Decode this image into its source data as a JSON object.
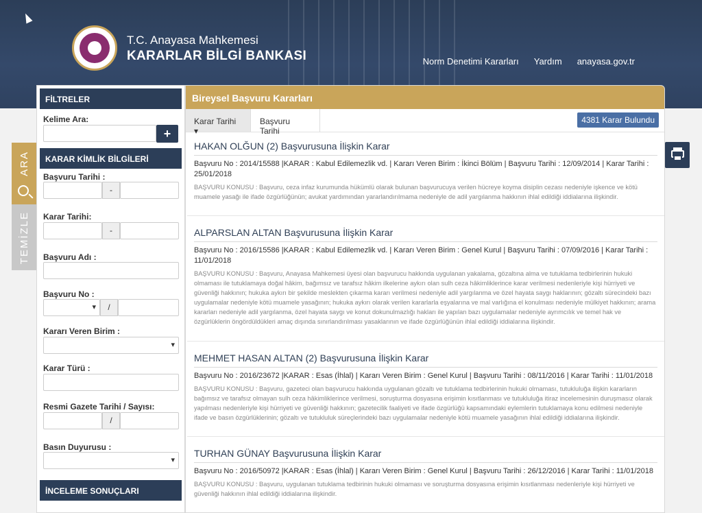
{
  "header": {
    "org": "T.C. Anayasa Mahkemesi",
    "title": "KARARLAR BİLGİ BANKASI",
    "nav": [
      "Norm Denetimi Kararları",
      "Yardım",
      "anayasa.gov.tr"
    ]
  },
  "side_tabs": {
    "search": "ARA",
    "clear": "TEMİZLE"
  },
  "filters": {
    "heading": "FİLTRELER",
    "keyword_label": "Kelime Ara:",
    "plus": "+",
    "identity_heading": "KARAR KİMLİK BİLGİLERİ",
    "application_date_label": "Başvuru Tarihi :",
    "decision_date_label": "Karar Tarihi:",
    "application_name_label": "Başvuru Adı :",
    "application_no_label": "Başvuru No :",
    "court_unit_label": "Kararı Veren Birim :",
    "decision_type_label": "Karar Türü :",
    "gazette_label": "Resmi Gazete Tarihi / Sayısı:",
    "press_label": "Basın Duyurusu :",
    "results_heading": "İNCELEME SONUÇLARI",
    "dash": "-",
    "slash": "/"
  },
  "results": {
    "heading": "Bireysel Başvuru Kararları",
    "sort_decision_date": "Karar Tarihi",
    "sort_application_date": "Başvuru Tarihi",
    "count": "4381 Karar Bulundu",
    "items": [
      {
        "title": "HAKAN OLĞUN (2) Başvurusuna İlişkin Karar",
        "meta": "Başvuru No : 2014/15588 |KARAR : Kabul Edilemezlik vd. | Kararı Veren Birim : İkinci Bölüm | Başvuru Tarihi : 12/09/2014 | Karar Tarihi : 25/01/2018",
        "summary": "BAŞVURU KONUSU : Başvuru, ceza infaz kurumunda hükümlü olarak bulunan başvurucuya verilen hücreye koyma disiplin cezası nedeniyle işkence ve kötü muamele yasağı ile ifade özgürlüğünün; avukat yardımından yararlandırılmama nedeniyle de adil yargılanma hakkının ihlal edildiği iddialarına ilişkindir."
      },
      {
        "title": "ALPARSLAN ALTAN Başvurusuna İlişkin Karar",
        "meta": "Başvuru No : 2016/15586 |KARAR : Kabul Edilemezlik vd. | Kararı Veren Birim : Genel Kurul | Başvuru Tarihi : 07/09/2016 | Karar Tarihi : 11/01/2018",
        "summary": "BAŞVURU KONUSU : Başvuru, Anayasa Mahkemesi üyesi olan başvurucu hakkında uygulanan yakalama, gözaltına alma ve tutuklama tedbirlerinin hukuki olmaması ile tutuklamaya doğal hâkim, bağımsız ve tarafsız hâkim ilkelerine aykırı olan sulh ceza hâkimliklerince karar verilmesi nedenleriyle kişi hürriyeti ve güvenliği hakkının; hukuka aykırı bir şekilde meslekten çıkarma kararı verilmesi nedeniyle adil yargılanma ve özel hayata saygı haklarının; gözaltı sürecindeki bazı uygulamalar nedeniyle kötü muamele yasağının; hukuka aykırı olarak verilen kararlarla eşyalarına ve mal varlığına el konulması nedeniyle mülkiyet hakkının; arama kararları nedeniyle adil yargılanma, özel hayata saygı ve konut dokunulmazlığı hakları ile yapılan bazı uygulamalar nedeniyle ayrımcılık ve temel hak ve özgürlüklerin öngördüldükleri amaç dışında sınırlandırılması yasaklarının ve ifade özgürlüğünün ihlal edildiği iddialarına ilişkindir."
      },
      {
        "title": "MEHMET HASAN ALTAN (2) Başvurusuna İlişkin Karar",
        "meta": "Başvuru No : 2016/23672 |KARAR : Esas (İhlal) | Kararı Veren Birim : Genel Kurul | Başvuru Tarihi : 08/11/2016 | Karar Tarihi : 11/01/2018",
        "summary": "BAŞVURU KONUSU : Başvuru, gazeteci olan başvurucu hakkında uygulanan gözaltı ve tutuklama tedbirlerinin hukuki olmaması, tutukluluğa ilişkin kararların bağımsız ve tarafsız olmayan sulh ceza hâkimliklerince verilmesi, soruşturma dosyasına erişimin kısıtlanması ve tutukluluğa itiraz incelemesinin duruşmasız olarak yapılması nedenleriyle kişi hürriyeti ve güvenliği hakkının; gazetecilik faaliyeti ve ifade özgürlüğü kapsamındaki eylemlerin tutuklamaya konu edilmesi nedeniyle ifade ve basın özgürlüklerinin; gözaltı ve tutukluluk süreçlerindeki bazı uygulamalar nedeniyle kötü muamele yasağının ihlal edildiği iddialarına ilişkindir."
      },
      {
        "title": "TURHAN GÜNAY Başvurusuna İlişkin Karar",
        "meta": "Başvuru No : 2016/50972 |KARAR : Esas (İhlal) | Kararı Veren Birim : Genel Kurul | Başvuru Tarihi : 26/12/2016 | Karar Tarihi : 11/01/2018",
        "summary": "BAŞVURU KONUSU : Başvuru, uygulanan tutuklama tedbirinin hukuki olmaması ve soruşturma dosyasına erişimin kısıtlanması nedenleriyle kişi hürriyeti ve güvenliği hakkının ihlal edildiği iddialarına ilişkindir."
      }
    ]
  },
  "colors": {
    "navy": "#2c3e58",
    "gold": "#c9a55a",
    "badge": "#4a6fa5"
  }
}
